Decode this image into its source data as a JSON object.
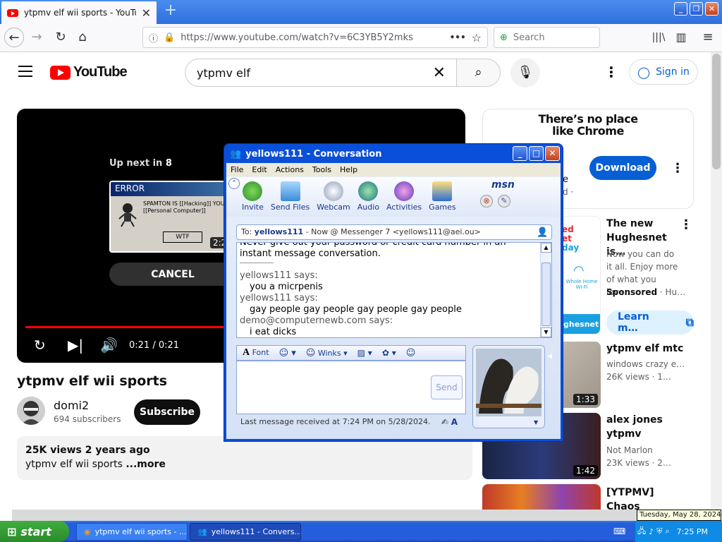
{
  "browser": {
    "tab_title": "ytpmv elf wii sports - YouTube",
    "tab_close": "✕",
    "new_tab": "+",
    "url": "https://www.youtube.com/watch?v=6C3YB5Y2mks",
    "url_more": "•••",
    "search_placeholder": "Search",
    "win_min": "_",
    "win_max": "❐",
    "win_close": "✕"
  },
  "youtube": {
    "logo_text": "YouTube",
    "search_value": "ytpmv elf",
    "signin_label": "Sign in",
    "player": {
      "upnext_label": "Up next in ",
      "upnext_count": "8",
      "thumb_title": "ERROR",
      "thumb_msg": "SPAMTON IS [[Hacking]] YOU [[Personal Computer]]",
      "thumb_btn": "WTF",
      "thumb_duration": "2:2",
      "cancel_label": "CANCEL",
      "time": "0:21 / 0:21"
    },
    "video": {
      "title": "ytpmv elf wii sports",
      "channel": "domi2",
      "subscribers": "694 subscribers",
      "subscribe_label": "Subscribe",
      "views_age": "25K views  2 years ago",
      "description": "ytpmv elf wii sports",
      "more_label": "...more"
    },
    "ad": {
      "tagline1": "There’s no place",
      "tagline2": "like Chrome",
      "download_label": "Download",
      "snippet_e": "e",
      "snippet_d": "d ·"
    },
    "sidebar": {
      "ad2_title": "The new Hughesnet is…",
      "ad2_sub": "Now you can do it all. Enjoy more of what you love…",
      "ad2_sponsored": "Sponsored",
      "ad2_sponsor": "· Hu…",
      "ad2_thumb_l1": "ed",
      "ad2_thumb_l2": "et",
      "ad2_thumb_l3": "day",
      "ad2_thumb_wifi": "Whole Home Wi-Fi",
      "ad2_thumb_brand": "ghesnet",
      "learn_label": "Learn m…",
      "items": [
        {
          "title": "ytpmv elf mtc",
          "channel": "windows crazy e…",
          "meta": "26K views · 1…",
          "duration": "1:33"
        },
        {
          "title": "alex jones ytpmv",
          "channel": "Not Marlon",
          "meta": "23K views · 2…",
          "duration": "1:42"
        },
        {
          "title": "[YTPMV] Chaos Robotking…"
        }
      ]
    }
  },
  "msn": {
    "title": "yellows111 - Conversation",
    "menu": [
      "File",
      "Edit",
      "Actions",
      "Tools",
      "Help"
    ],
    "tools": [
      "Invite",
      "Send Files",
      "Webcam",
      "Audio",
      "Activities",
      "Games"
    ],
    "logo": "msn",
    "to_label": "To: ",
    "to_name": "yellows111",
    "to_rest": " - Now @ Messenger 7 <yellows111@aei.ou>",
    "chat": {
      "notice": "Never give out your password or credit card number in an instant message conversation.",
      "messages": [
        {
          "who": "yellows111 says:",
          "text": "you a micrpenis"
        },
        {
          "who": "yellows111 says:",
          "text": "gay people gay people gay people gay people"
        },
        {
          "who": "demo@computernewb.com says:",
          "text": "i eat dicks"
        }
      ]
    },
    "format": {
      "font": "Font",
      "winks": "Winks"
    },
    "send_label": "Send",
    "status": "Last message received at 7:24 PM on 5/28/2024."
  },
  "taskbar": {
    "start": "start",
    "tasks": [
      "ytpmv elf wii sports - ...",
      "yellows111 - Convers..."
    ],
    "clock": "7:25 PM",
    "date_tip": "Tuesday, May 28, 2024"
  },
  "colors": {
    "yt_red": "#ff0000",
    "yt_blue": "#065fd4",
    "xp_blue": "#245edb",
    "xp_green": "#3fae3f"
  }
}
